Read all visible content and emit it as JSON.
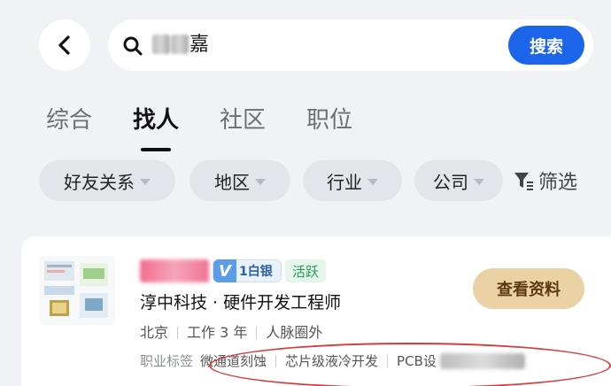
{
  "header": {
    "search_query_visible": "嘉",
    "search_button_label": "搜索"
  },
  "tabs": [
    {
      "label": "综合",
      "active": false
    },
    {
      "label": "找人",
      "active": true
    },
    {
      "label": "社区",
      "active": false
    },
    {
      "label": "职位",
      "active": false
    }
  ],
  "filters": {
    "chips": [
      "好友关系",
      "地区",
      "行业",
      "公司"
    ],
    "filter_label": "筛选"
  },
  "result": {
    "vip_badge": "V1白银",
    "vip_badge_letter": "V",
    "vip_badge_text": "1白银",
    "active_status": "活跃",
    "title": "淳中科技 · 硬件开发工程师",
    "location": "北京",
    "experience": "工作 3 年",
    "network": "人脉圈外",
    "tag_label": "职业标签",
    "tags": [
      "微通道刻蚀",
      "芯片级液冷开发",
      "PCB设"
    ],
    "action_button": "查看资料"
  },
  "colors": {
    "accent_blue": "#1c64ea",
    "action_gold": "#ebd2a4",
    "active_green": "#2a9a56",
    "annotation_red": "#d63a3a"
  }
}
